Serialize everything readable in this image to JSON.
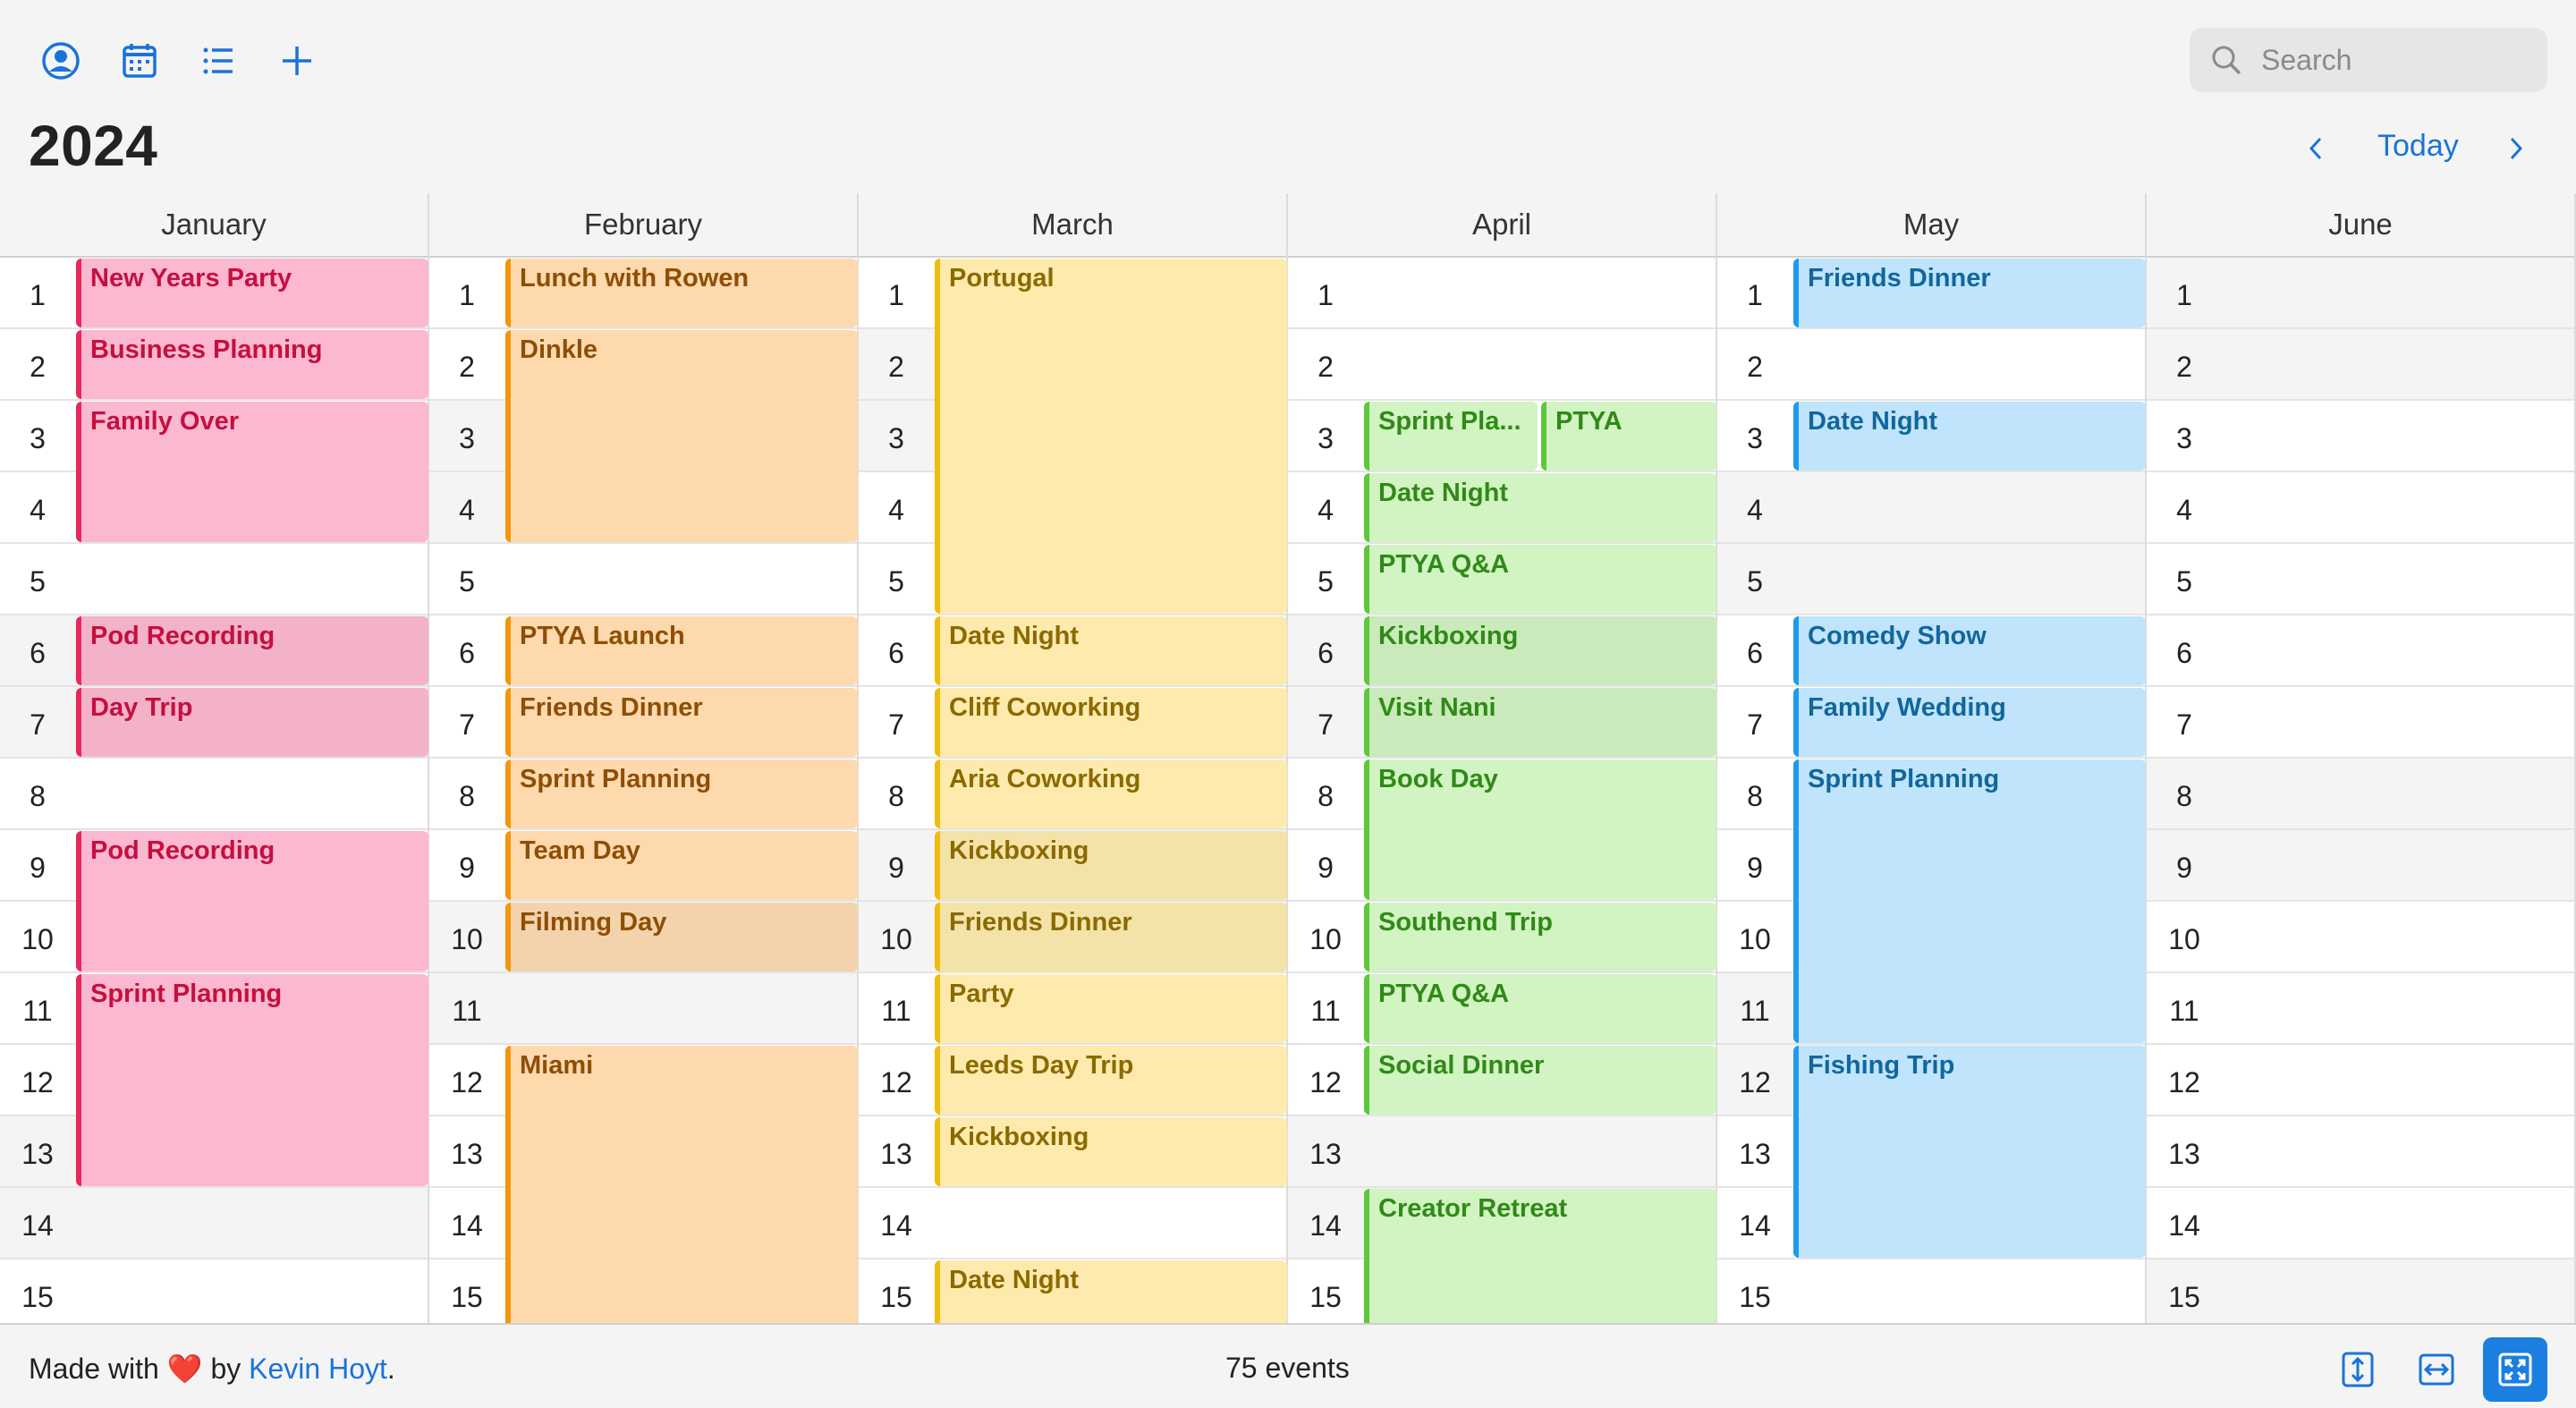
{
  "toolbar": {
    "icons": [
      "account-icon",
      "calendar-icon",
      "list-icon",
      "plus-icon"
    ],
    "search_placeholder": "Search"
  },
  "header": {
    "year": "2024",
    "today_label": "Today"
  },
  "months": [
    {
      "name": "January",
      "weekends": [
        6,
        7,
        13,
        14
      ],
      "events": [
        {
          "title": "New Years Party",
          "start": 1,
          "end": 1,
          "color": "pink"
        },
        {
          "title": "Business Planning",
          "start": 2,
          "end": 2,
          "color": "pink"
        },
        {
          "title": "Family Over",
          "start": 3,
          "end": 4,
          "color": "pink"
        },
        {
          "title": "Pod Recording",
          "start": 6,
          "end": 6,
          "color": "pink"
        },
        {
          "title": "Day Trip",
          "start": 7,
          "end": 7,
          "color": "pink"
        },
        {
          "title": "Pod Recording",
          "start": 9,
          "end": 10,
          "color": "pink"
        },
        {
          "title": "Sprint Planning",
          "start": 11,
          "end": 13,
          "color": "pink"
        }
      ]
    },
    {
      "name": "February",
      "weekends": [
        3,
        4,
        10,
        11
      ],
      "events": [
        {
          "title": "Lunch with Rowen",
          "start": 1,
          "end": 1,
          "color": "orange"
        },
        {
          "title": "Dinkle",
          "start": 2,
          "end": 4,
          "color": "orange"
        },
        {
          "title": "PTYA Launch",
          "start": 6,
          "end": 6,
          "color": "orange"
        },
        {
          "title": "Friends Dinner",
          "start": 7,
          "end": 7,
          "color": "orange"
        },
        {
          "title": "Sprint Planning",
          "start": 8,
          "end": 8,
          "color": "orange"
        },
        {
          "title": "Team Day",
          "start": 9,
          "end": 9,
          "color": "orange"
        },
        {
          "title": "Filming Day",
          "start": 10,
          "end": 10,
          "color": "orange"
        },
        {
          "title": "Miami",
          "start": 12,
          "end": 15,
          "color": "orange"
        }
      ]
    },
    {
      "name": "March",
      "weekends": [
        2,
        3,
        9,
        10
      ],
      "events": [
        {
          "title": "Portugal",
          "start": 1,
          "end": 5,
          "color": "yellow"
        },
        {
          "title": "Date Night",
          "start": 6,
          "end": 6,
          "color": "yellow"
        },
        {
          "title": "Cliff Coworking",
          "start": 7,
          "end": 7,
          "color": "yellow"
        },
        {
          "title": "Aria Coworking",
          "start": 8,
          "end": 8,
          "color": "yellow"
        },
        {
          "title": "Kickboxing",
          "start": 9,
          "end": 9,
          "color": "yellow"
        },
        {
          "title": "Friends Dinner",
          "start": 10,
          "end": 10,
          "color": "yellow"
        },
        {
          "title": "Party",
          "start": 11,
          "end": 11,
          "color": "yellow"
        },
        {
          "title": "Leeds Day Trip",
          "start": 12,
          "end": 12,
          "color": "yellow"
        },
        {
          "title": "Kickboxing",
          "start": 13,
          "end": 13,
          "color": "yellow"
        },
        {
          "title": "Date Night",
          "start": 15,
          "end": 15,
          "color": "yellow"
        }
      ]
    },
    {
      "name": "April",
      "weekends": [
        6,
        7,
        13,
        14
      ],
      "events": [
        {
          "title": "Sprint Pla...",
          "start": 3,
          "end": 3,
          "color": "green",
          "lane": "left"
        },
        {
          "title": "PTYA",
          "start": 3,
          "end": 3,
          "color": "green",
          "lane": "right"
        },
        {
          "title": "Date Night",
          "start": 4,
          "end": 4,
          "color": "green"
        },
        {
          "title": "PTYA Q&A",
          "start": 5,
          "end": 5,
          "color": "green"
        },
        {
          "title": "Kickboxing",
          "start": 6,
          "end": 6,
          "color": "green"
        },
        {
          "title": "Visit Nani",
          "start": 7,
          "end": 7,
          "color": "green"
        },
        {
          "title": "Book Day",
          "start": 8,
          "end": 9,
          "color": "green"
        },
        {
          "title": "Southend Trip",
          "start": 10,
          "end": 10,
          "color": "green"
        },
        {
          "title": "PTYA Q&A",
          "start": 11,
          "end": 11,
          "color": "green"
        },
        {
          "title": "Social Dinner",
          "start": 12,
          "end": 12,
          "color": "green"
        },
        {
          "title": "Creator Retreat",
          "start": 14,
          "end": 15,
          "color": "green"
        }
      ]
    },
    {
      "name": "May",
      "weekends": [
        4,
        5,
        11,
        12
      ],
      "events": [
        {
          "title": "Friends Dinner",
          "start": 1,
          "end": 1,
          "color": "blue"
        },
        {
          "title": "Date Night",
          "start": 3,
          "end": 3,
          "color": "blue"
        },
        {
          "title": "Comedy Show",
          "start": 6,
          "end": 6,
          "color": "blue"
        },
        {
          "title": "Family Wedding",
          "start": 7,
          "end": 7,
          "color": "blue"
        },
        {
          "title": "Sprint Planning",
          "start": 8,
          "end": 11,
          "color": "blue"
        },
        {
          "title": "Fishing Trip",
          "start": 12,
          "end": 14,
          "color": "blue"
        }
      ]
    },
    {
      "name": "June",
      "weekends": [
        1,
        2,
        8,
        9,
        15
      ],
      "events": []
    }
  ],
  "footer": {
    "made_with": "Made with",
    "heart": "❤️",
    "by": "by",
    "author": "Kevin Hoyt",
    "period": ".",
    "event_count": "75 events",
    "buttons": [
      "fit-height-icon",
      "fit-width-icon",
      "fit-all-icon"
    ]
  }
}
